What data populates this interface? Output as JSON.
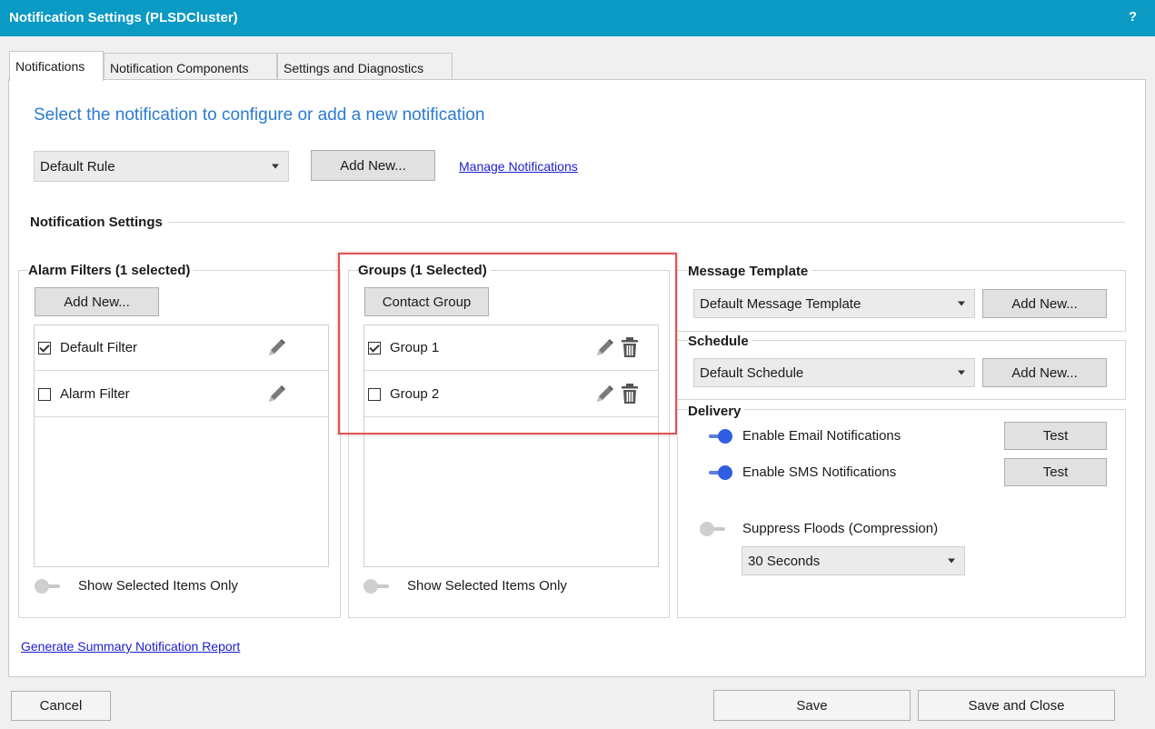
{
  "window": {
    "title": "Notification Settings (PLSDCluster)",
    "help": "?"
  },
  "tabs": [
    {
      "label": "Notifications",
      "active": true
    },
    {
      "label": "Notification Components",
      "active": false
    },
    {
      "label": "Settings and Diagnostics",
      "active": false
    }
  ],
  "header": {
    "headline": "Select the notification to configure or add a new notification",
    "selected_notification": "Default Rule",
    "add_new": "Add New...",
    "manage_link": "Manage Notifications"
  },
  "notification_settings": {
    "title": "Notification Settings"
  },
  "alarm_filters": {
    "title": "Alarm Filters (1 selected)",
    "add_new": "Add New...",
    "items": [
      {
        "label": "Default Filter",
        "checked": true
      },
      {
        "label": "Alarm Filter",
        "checked": false
      }
    ],
    "show_selected": "Show Selected Items Only"
  },
  "groups": {
    "title": "Groups (1 Selected)",
    "contact_group": "Contact Group",
    "items": [
      {
        "label": "Group 1",
        "checked": true
      },
      {
        "label": "Group 2",
        "checked": false
      }
    ],
    "show_selected": "Show Selected Items Only"
  },
  "message_template": {
    "title": "Message Template",
    "selected": "Default Message Template",
    "add_new": "Add New..."
  },
  "schedule": {
    "title": "Schedule",
    "selected": "Default Schedule",
    "add_new": "Add New..."
  },
  "delivery": {
    "title": "Delivery",
    "email": {
      "label": "Enable Email Notifications",
      "enabled": true,
      "test": "Test"
    },
    "sms": {
      "label": "Enable SMS Notifications",
      "enabled": true,
      "test": "Test"
    },
    "suppress": {
      "label": "Suppress Floods (Compression)",
      "enabled": false,
      "interval": "30 Seconds"
    }
  },
  "footer": {
    "report_link": "Generate Summary Notification Report",
    "cancel": "Cancel",
    "save": "Save",
    "save_close": "Save and Close"
  },
  "colors": {
    "titlebar": "#0a9ac4",
    "headline": "#2b7bd3",
    "link": "#1c1ccf",
    "toggle_on": "#2f5fe0",
    "highlight_box": "#e05555"
  }
}
